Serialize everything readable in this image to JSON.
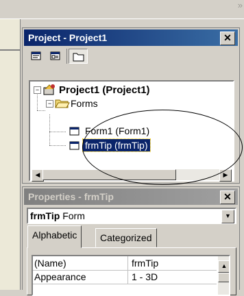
{
  "toolbar": {
    "overflow_glyph": "»"
  },
  "project": {
    "title": "Project - Project1",
    "close_glyph": "✕",
    "buttons": [
      "view-code",
      "view-object",
      "toggle-folders"
    ],
    "tree": {
      "root": "Project1 (Project1)",
      "folder": "Forms",
      "items": [
        "Form1 (Form1)",
        "frmTip (frmTip)"
      ],
      "selected": "frmTip (frmTip)"
    },
    "scroll_left": "◀",
    "scroll_right": "▶"
  },
  "properties": {
    "title": "Properties - frmTip",
    "close_glyph": "✕",
    "object_name": "frmTip",
    "object_type": "Form",
    "dropdown_glyph": "▼",
    "tabs": [
      "Alphabetic",
      "Categorized"
    ],
    "active_tab": "Alphabetic",
    "rows": [
      {
        "name": "(Name)",
        "value": "frmTip"
      },
      {
        "name": "Appearance",
        "value": "1 - 3D"
      }
    ],
    "scroll_up": "▲"
  },
  "colors": {
    "titlebar_active": "#0a246a",
    "titlebar_inactive": "#808080",
    "face": "#d4d0c8",
    "selection": "#0a246a"
  }
}
